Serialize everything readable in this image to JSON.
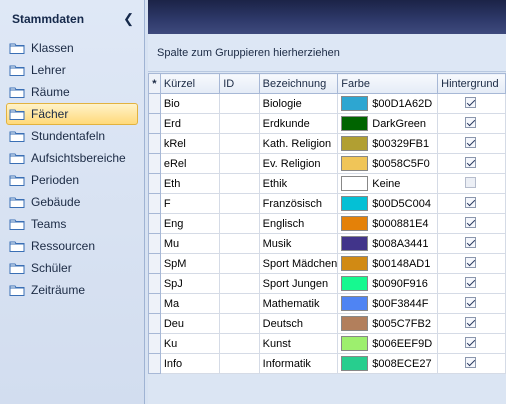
{
  "sidebar": {
    "title": "Stammdaten",
    "collapse_icon": "chevron-left-icon",
    "items": [
      {
        "label": "Klassen"
      },
      {
        "label": "Lehrer"
      },
      {
        "label": "Räume"
      },
      {
        "label": "Fächer",
        "selected": true
      },
      {
        "label": "Stundentafeln"
      },
      {
        "label": "Aufsichtsbereiche"
      },
      {
        "label": "Perioden"
      },
      {
        "label": "Gebäude"
      },
      {
        "label": "Teams"
      },
      {
        "label": "Ressourcen"
      },
      {
        "label": "Schüler"
      },
      {
        "label": "Zeiträume"
      }
    ]
  },
  "grid": {
    "group_panel_text": "Spalte zum Gruppieren hierherziehen",
    "indicator_header": "*",
    "columns": [
      "Kürzel",
      "ID",
      "Bezeichnung",
      "Farbe",
      "Hintergrund"
    ],
    "rows": [
      {
        "kuerzel": "Bio",
        "id": "",
        "bezeichnung": "Biologie",
        "farbe": "$00D1A62D",
        "color": "#2DA6D1",
        "hintergrund": true
      },
      {
        "kuerzel": "Erd",
        "id": "",
        "bezeichnung": "Erdkunde",
        "farbe": "DarkGreen",
        "color": "#006400",
        "hintergrund": true
      },
      {
        "kuerzel": "kRel",
        "id": "",
        "bezeichnung": "Kath. Religion",
        "farbe": "$00329FB1",
        "color": "#B19F32",
        "hintergrund": true
      },
      {
        "kuerzel": "eRel",
        "id": "",
        "bezeichnung": "Ev. Religion",
        "farbe": "$0058C5F0",
        "color": "#F0C558",
        "hintergrund": true
      },
      {
        "kuerzel": "Eth",
        "id": "",
        "bezeichnung": "Ethik",
        "farbe": "Keine",
        "color": "#FFFFFF",
        "hintergrund": false
      },
      {
        "kuerzel": "F",
        "id": "",
        "bezeichnung": "Französisch",
        "farbe": "$00D5C004",
        "color": "#04C0D5",
        "hintergrund": true
      },
      {
        "kuerzel": "Eng",
        "id": "",
        "bezeichnung": "Englisch",
        "farbe": "$000881E4",
        "color": "#E48108",
        "hintergrund": true
      },
      {
        "kuerzel": "Mu",
        "id": "",
        "bezeichnung": "Musik",
        "farbe": "$008A3441",
        "color": "#41348A",
        "hintergrund": true
      },
      {
        "kuerzel": "SpM",
        "id": "",
        "bezeichnung": "Sport Mädchen",
        "farbe": "$00148AD1",
        "color": "#D18A14",
        "hintergrund": true
      },
      {
        "kuerzel": "SpJ",
        "id": "",
        "bezeichnung": "Sport Jungen",
        "farbe": "$0090F916",
        "color": "#16F990",
        "hintergrund": true
      },
      {
        "kuerzel": "Ma",
        "id": "",
        "bezeichnung": "Mathematik",
        "farbe": "$00F3844F",
        "color": "#4F84F3",
        "hintergrund": true
      },
      {
        "kuerzel": "Deu",
        "id": "",
        "bezeichnung": "Deutsch",
        "farbe": "$005C7FB2",
        "color": "#B27F5C",
        "hintergrund": true
      },
      {
        "kuerzel": "Ku",
        "id": "",
        "bezeichnung": "Kunst",
        "farbe": "$006EEF9D",
        "color": "#9DEF6E",
        "hintergrund": true
      },
      {
        "kuerzel": "Info",
        "id": "",
        "bezeichnung": "Informatik",
        "farbe": "$008ECE27",
        "color": "#27CE8E",
        "hintergrund": true
      }
    ]
  }
}
